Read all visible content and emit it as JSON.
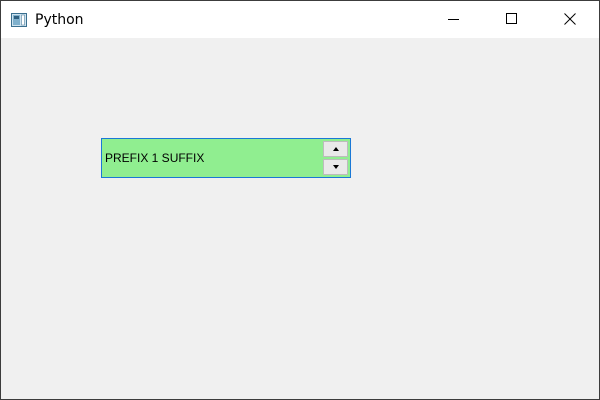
{
  "window": {
    "title": "Python",
    "icon": "python-app-icon"
  },
  "titlebar_buttons": {
    "minimize": "minimize-icon",
    "maximize": "maximize-icon",
    "close": "close-icon"
  },
  "spinbox": {
    "prefix": "PREFIX ",
    "value": "1",
    "suffix": " SUFFIX",
    "display_text": "PREFIX 1 SUFFIX",
    "background_color": "#90ee90",
    "border_color": "#1a78d6",
    "up_icon": "arrow-up-icon",
    "down_icon": "arrow-down-icon"
  }
}
